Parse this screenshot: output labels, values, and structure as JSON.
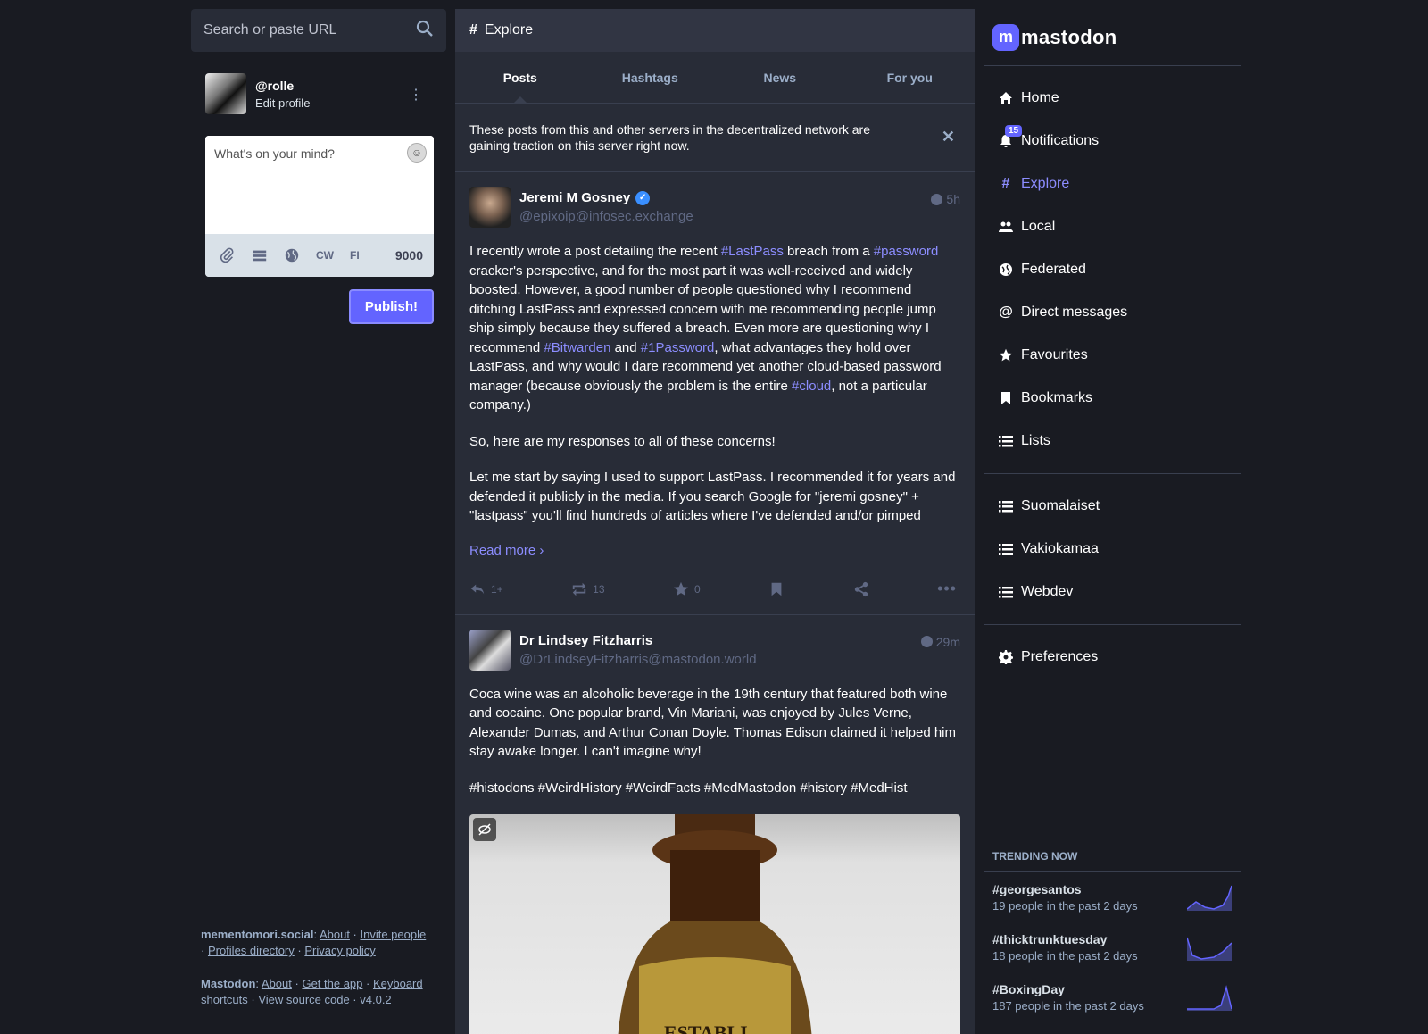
{
  "search": {
    "placeholder": "Search or paste URL",
    "icon": "search-icon"
  },
  "profile": {
    "handle": "@rolle",
    "edit_label": "Edit profile"
  },
  "composer": {
    "placeholder": "What's on your mind?",
    "tools": [
      "paperclip-icon",
      "poll-icon",
      "globe-icon"
    ],
    "cw_label": "CW",
    "lang_label": "FI",
    "char_count": "9000",
    "publish_label": "Publish!"
  },
  "footer": {
    "server": "mementomori.social",
    "server_links": [
      "About",
      "Invite people",
      "Profiles directory",
      "Privacy policy"
    ],
    "app": "Mastodon",
    "app_links": [
      "About",
      "Get the app",
      "Keyboard shortcuts",
      "View source code"
    ],
    "version": "v4.0.2"
  },
  "column": {
    "title": "Explore",
    "tabs": [
      {
        "label": "Posts",
        "active": true
      },
      {
        "label": "Hashtags",
        "active": false
      },
      {
        "label": "News",
        "active": false
      },
      {
        "label": "For you",
        "active": false
      }
    ],
    "dismissable": "These posts from this and other servers in the decentralized network are gaining traction on this server right now."
  },
  "posts": [
    {
      "display_name": "Jeremi M Gosney",
      "acct": "@epixoip@infosec.exchange",
      "time": "5h",
      "verified": true,
      "p1_a": "I recently wrote a post detailing the recent ",
      "tag_lastpass": "#LastPass",
      "p1_b": " breach from a ",
      "tag_password": "#password",
      "p1_c": " cracker's perspective, and for the most part it was well-received and widely boosted. However, a good number of people questioned why I recommend ditching LastPass and expressed concern with me recommending people jump ship simply because they suffered a breach. Even more are questioning why I recommend ",
      "tag_bitwarden": "#Bitwarden",
      "p1_d": " and ",
      "tag_1password": "#1Password",
      "p1_e": ", what advantages they hold over LastPass, and why would I dare recommend yet another cloud-based password manager (because obviously the problem is the entire ",
      "tag_cloud": "#cloud",
      "p1_f": ", not a particular company.)",
      "p2": "So, here are my responses to all of these concerns!",
      "p3": "Let me start by saying I used to support LastPass. I recommended it for years and defended it publicly in the media. If you search Google for \"jeremi gosney\" + \"lastpass\" you'll find hundreds of articles where I've defended and/or pimped",
      "read_more": "Read more",
      "replies": "1+",
      "boosts": "13",
      "favourites": "0"
    },
    {
      "display_name": "Dr Lindsey Fitzharris",
      "acct": "@DrLindseyFitzharris@mastodon.world",
      "time": "29m",
      "p1": "Coca wine was an alcoholic beverage in the 19th century that featured both wine and cocaine. One popular brand, Vin Mariani, was enjoyed by Jules Verne, Alexander Dumas, and Arthur Conan Doyle. Thomas Edison claimed it helped him stay awake longer. I can't imagine why!",
      "tags": "#histodons #WeirdHistory #WeirdFacts #MedMastodon #history #MedHist",
      "media_label": "ESTABLI"
    }
  ],
  "brand": {
    "name": "mastodon",
    "accent": "#6364ff"
  },
  "nav": {
    "primary": [
      {
        "label": "Home",
        "icon": "home-icon"
      },
      {
        "label": "Notifications",
        "icon": "bell-icon",
        "badge": "15"
      },
      {
        "label": "Explore",
        "icon": "hashtag-icon",
        "active": true
      },
      {
        "label": "Local",
        "icon": "users-icon"
      },
      {
        "label": "Federated",
        "icon": "globe-icon"
      },
      {
        "label": "Direct messages",
        "icon": "at-icon"
      },
      {
        "label": "Favourites",
        "icon": "star-icon"
      },
      {
        "label": "Bookmarks",
        "icon": "bookmark-icon"
      },
      {
        "label": "Lists",
        "icon": "list-icon"
      }
    ],
    "lists": [
      {
        "label": "Suomalaiset",
        "icon": "list-icon"
      },
      {
        "label": "Vakiokamaa",
        "icon": "list-icon"
      },
      {
        "label": "Webdev",
        "icon": "list-icon"
      }
    ],
    "preferences": {
      "label": "Preferences",
      "icon": "gear-icon"
    }
  },
  "trending": {
    "title": "TRENDING NOW",
    "items": [
      {
        "name": "#georgesantos",
        "uses": "19 people in the past 2 days"
      },
      {
        "name": "#thicktrunktuesday",
        "uses": "18 people in the past 2 days"
      },
      {
        "name": "#BoxingDay",
        "uses": "187 people in the past 2 days"
      }
    ]
  }
}
